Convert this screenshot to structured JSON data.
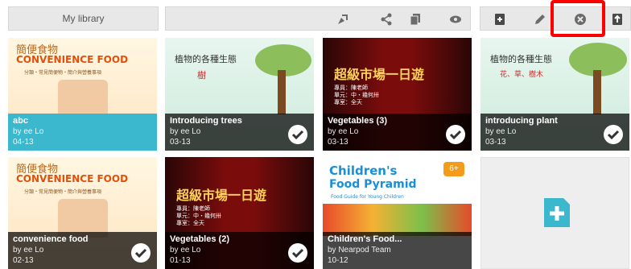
{
  "toolbar": {
    "library_label": "My library",
    "icons": [
      "edit-icon",
      "share-icon",
      "copy-icon",
      "preview-icon"
    ],
    "right_icons": [
      "new-icon",
      "pencil-icon",
      "delete-icon",
      "export-icon"
    ]
  },
  "cards": [
    {
      "title": "abc",
      "author": "by ee Lo",
      "date": "04-13",
      "selected": true,
      "thumb_cn": "簡便食物",
      "thumb_en": "CONVENIENCE FOOD",
      "thumb_sub": "分類・常見簡便物・簡介與營養事項"
    },
    {
      "title": "Introducing trees",
      "author": "by ee Lo",
      "date": "03-13",
      "selected": false,
      "thumb_cn": "植物的各種生態",
      "thumb_sub": "樹"
    },
    {
      "title": "Vegetables (3)",
      "author": "by ee Lo",
      "date": "03-13",
      "selected": false,
      "thumb_cn": "超級市場一日遊",
      "thumb_sub": "專員：陳老師\n單元：中・幾何卅\n專室：全天"
    },
    {
      "title": "introducing plant",
      "author": "by ee Lo",
      "date": "03-13",
      "selected": false,
      "thumb_cn": "植物的各種生態",
      "thumb_sub": "花、草、樹木"
    },
    {
      "title": "convenience food",
      "author": "by ee Lo",
      "date": "02-13",
      "selected": false,
      "thumb_cn": "簡便食物",
      "thumb_en": "CONVENIENCE FOOD",
      "thumb_sub": "分類・常見簡便物・簡介與營養事項"
    },
    {
      "title": "Vegetables (2)",
      "author": "by ee Lo",
      "date": "01-13",
      "selected": false,
      "thumb_cn": "超級市場一日遊",
      "thumb_sub": "專員：陳老師\n單元：中・幾何卅\n專室：全天"
    },
    {
      "title": "Children's Food...",
      "author": "by Nearpod Team",
      "date": "10-12",
      "selected": false,
      "thumb_en1": "Children's",
      "thumb_en2": "Food Pyramid",
      "thumb_sub": "Food Guide for Young Children",
      "badge": "6+"
    }
  ],
  "colors": {
    "selected": "#3bb7ce",
    "accent": "#3bb7ce",
    "highlight": "#ff0000"
  }
}
